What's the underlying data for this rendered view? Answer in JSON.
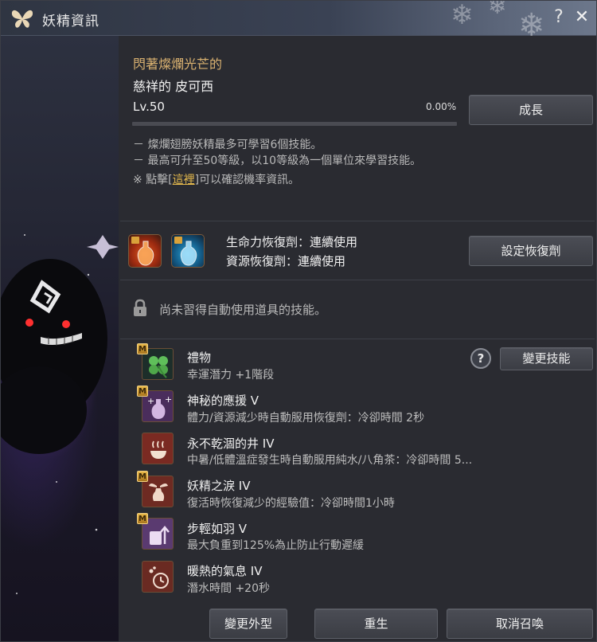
{
  "window": {
    "title": "妖精資訊",
    "help_glyph": "?",
    "close_glyph": "✕"
  },
  "fairy": {
    "prefix": "閃著燦爛光芒的",
    "name": "慈祥的 皮可西",
    "level": "Lv.50",
    "exp_percent": "0.00%",
    "exp_fraction": 0,
    "grow_button": "成長"
  },
  "notes": {
    "line1": "－ 燦爛翅膀妖精最多可學習6個技能。",
    "line2": "－ 最高可升至50等級，以10等級為一個單位來學習技能。",
    "line3_prefix": "※ 點擊[",
    "line3_link": "這裡",
    "line3_suffix": "]可以確認機率資訊。"
  },
  "recovery": {
    "hp_label": "生命力恢復劑：連續使用",
    "mp_label": "資源恢復劑：連續使用",
    "button": "設定恢復劑"
  },
  "auto_item": {
    "text": "尚未習得自動使用道具的技能。"
  },
  "skills_section": {
    "change_button": "變更技能",
    "help_glyph": "?"
  },
  "skills": [
    {
      "name": "禮物",
      "desc": "幸運潛力 +1階段",
      "badge": "M",
      "icon": "clover-icon"
    },
    {
      "name": "神秘的應援 V",
      "desc": "體力/資源減少時自動服用恢復劑：冷卻時間 2秒",
      "badge": "M",
      "icon": "potion-buff-icon"
    },
    {
      "name": "永不乾涸的井 IV",
      "desc": "中暑/低體溫症發生時自動服用純水/八角茶：冷卻時間 5...",
      "badge": "",
      "icon": "hot-bowl-icon"
    },
    {
      "name": "妖精之淚 IV",
      "desc": "復活時恢復減少的經驗值：冷卻時間1小時",
      "badge": "M",
      "icon": "winged-vase-icon"
    },
    {
      "name": "步輕如羽 V",
      "desc": "最大負重到125%為止防止行動遲緩",
      "badge": "M",
      "icon": "weight-up-icon"
    },
    {
      "name": "暖熱的氣息 IV",
      "desc": "潛水時間 +20秒",
      "badge": "",
      "icon": "breath-timer-icon"
    }
  ],
  "footer": {
    "appearance_button": "變更外型",
    "rebirth_button": "重生",
    "dismiss_button": "取消召喚"
  },
  "colors": {
    "gold": "#d9b170",
    "link": "#e3b84d",
    "progress": "#c9a24e"
  }
}
